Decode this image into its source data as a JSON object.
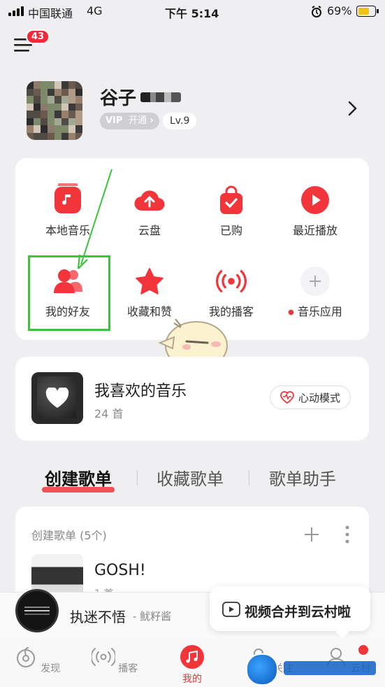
{
  "status_bar": {
    "carrier": "中国联通",
    "network": "4G",
    "time": "下午 5:14",
    "battery": "69%"
  },
  "header": {
    "notification_count": "43"
  },
  "profile": {
    "name": "谷子",
    "vip_label": "开通",
    "vip_prefix": "VIP",
    "level": "Lv.9"
  },
  "quick_grid": [
    {
      "label": "本地音乐",
      "icon": "local-music-icon"
    },
    {
      "label": "云盘",
      "icon": "cloud-upload-icon"
    },
    {
      "label": "已购",
      "icon": "purchased-bag-icon"
    },
    {
      "label": "最近播放",
      "icon": "recent-play-icon"
    },
    {
      "label": "我的好友",
      "icon": "friends-icon"
    },
    {
      "label": "收藏和赞",
      "icon": "star-icon"
    },
    {
      "label": "我的播客",
      "icon": "podcast-icon"
    },
    {
      "label": "音乐应用",
      "icon": "plus-icon"
    }
  ],
  "liked": {
    "title": "我喜欢的音乐",
    "count": "24 首",
    "heart_mode": "心动模式"
  },
  "tabs": [
    "创建歌单",
    "收藏歌单",
    "歌单助手"
  ],
  "created": {
    "header": "创建歌单 (5个)",
    "first_title": "GOSH!",
    "first_count": "1 首"
  },
  "player": {
    "title": "执迷不悟",
    "artist": "- 鱿籽酱"
  },
  "tooltip": {
    "text": "视频合并到云村啦"
  },
  "bottom_nav": [
    {
      "label": "发现",
      "icon": "discover-icon"
    },
    {
      "label": "播客",
      "icon": "podcast-nav-icon"
    },
    {
      "label": "我的",
      "icon": "my-music-icon"
    },
    {
      "label": "关注",
      "icon": "follow-icon"
    },
    {
      "label": "云村",
      "icon": "village-icon"
    }
  ],
  "colors": {
    "accent": "#f1353b",
    "annotation": "#3bc43b"
  }
}
